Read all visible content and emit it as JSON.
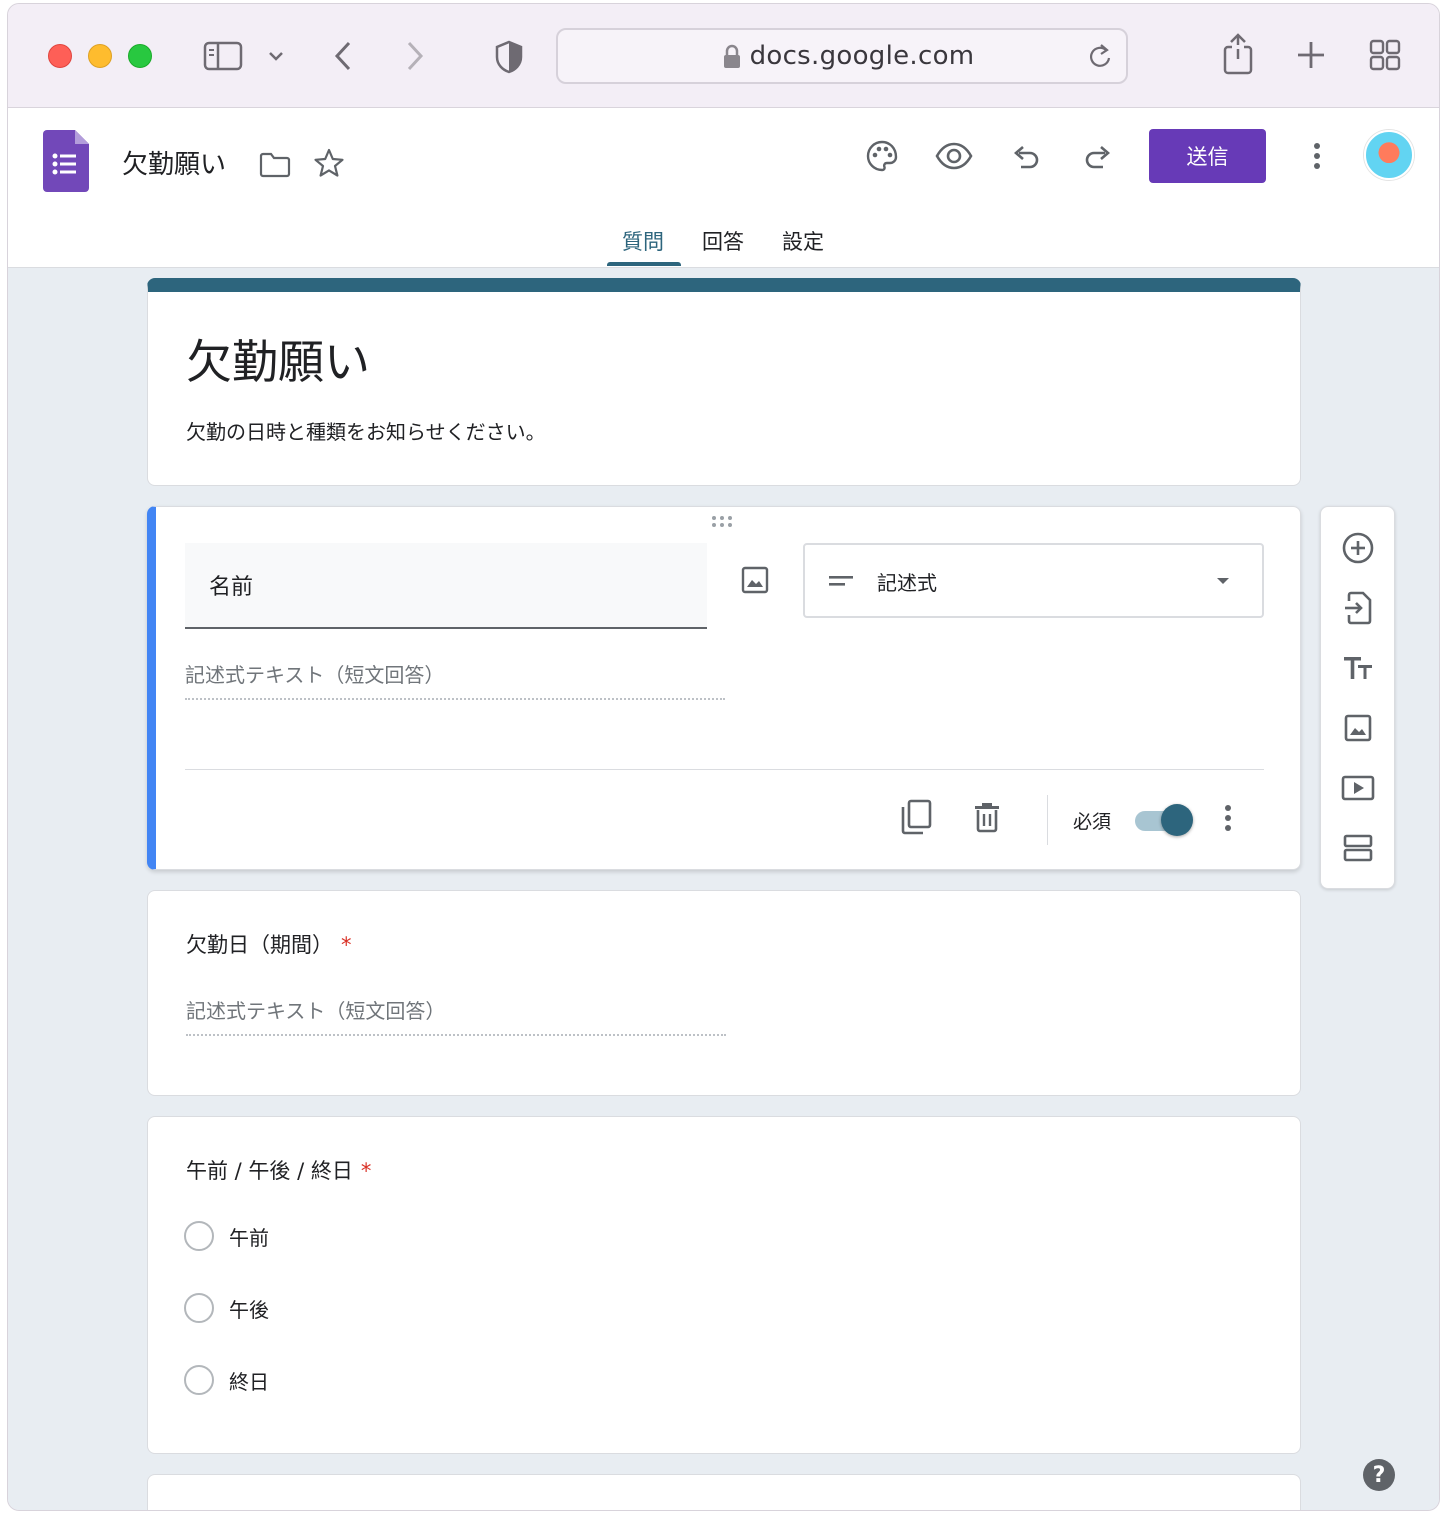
{
  "browser": {
    "url": "docs.google.com"
  },
  "header": {
    "doc_title": "欠勤願い",
    "send_label": "送信",
    "tabs": [
      {
        "label": "質問",
        "active": true
      },
      {
        "label": "回答",
        "active": false
      },
      {
        "label": "設定",
        "active": false
      }
    ],
    "accent_color": "#673ab7",
    "theme_color": "#2d657d"
  },
  "form": {
    "title": "欠勤願い",
    "description": "欠勤の日時と種類をお知らせください。"
  },
  "questions": [
    {
      "title": "名前",
      "type_label": "記述式",
      "answer_placeholder": "記述式テキスト（短文回答）",
      "required_label": "必須",
      "required": true
    },
    {
      "title": "欠勤日（期間）",
      "required_mark": "*",
      "answer_placeholder": "記述式テキスト（短文回答）"
    },
    {
      "title": "午前 / 午後 / 終日",
      "required_mark": "*",
      "options": [
        "午前",
        "午後",
        "終日"
      ]
    }
  ],
  "help_label": "?"
}
